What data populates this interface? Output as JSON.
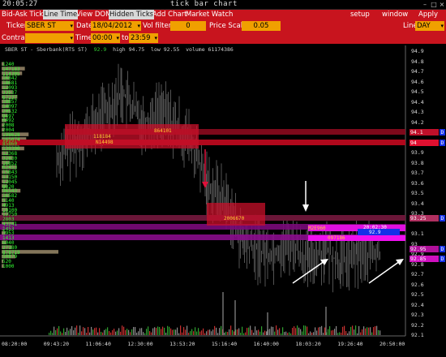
{
  "window": {
    "clock": "20:05:27",
    "title": "tick bar chart"
  },
  "menu": {
    "items": [
      "Bid-Ask Tick",
      "Line Time",
      "View DOM",
      "Hidden Ticks",
      "Add Chart",
      "Market Watch"
    ],
    "right": [
      "setup",
      "window",
      "Apply"
    ]
  },
  "controls": {
    "ticker_label": "Ticker",
    "ticker_value": "SBER ST",
    "date_label": "Date",
    "date_value": "18/04/2012",
    "vol_filter_label": "Vol filter",
    "vol_filter_value": "0",
    "price_scale_label": "Price Scale",
    "price_scale_value": "0.05",
    "line_label": "Line",
    "line_value": "DAY",
    "contract_label": "Contract",
    "time_label": "Time",
    "time_from": "00:00",
    "to_label": "to",
    "time_to": "23:59"
  },
  "chart_info": {
    "instrument": "SBER ST - Sberbank(RTS ST)",
    "last": "92.9",
    "high_label": "high",
    "high": "94.75",
    "low_label": "low",
    "low": "92.55",
    "volume_label": "volume",
    "volume": "61174386"
  },
  "chart_data": {
    "type": "bar",
    "price_axis": [
      "94.9",
      "94.8",
      "94.7",
      "94.6",
      "94.5",
      "94.4",
      "94.3",
      "94.2",
      "94.1",
      "94",
      "93.9",
      "93.8",
      "93.7",
      "93.6",
      "93.5",
      "93.4",
      "93.3",
      "93.25",
      "93.1",
      "93",
      "92.95",
      "92.9",
      "92.85",
      "92.8",
      "92.7",
      "92.6",
      "92.5",
      "92.4",
      "92.3",
      "92.2",
      "92.1"
    ],
    "time_axis": [
      "08:20:00",
      "09:43:20",
      "11:06:40",
      "12:30:00",
      "13:53:20",
      "15:16:40",
      "16:40:00",
      "18:03:20",
      "19:26:40",
      "20:50:00"
    ],
    "ylim": [
      92.1,
      94.9
    ],
    "volume_profile": [
      "1240",
      "147183",
      "114305",
      "16842",
      "18681",
      "12093",
      "33537",
      "67237",
      "18857",
      "14097",
      "20532",
      "9497",
      "6492",
      "2008",
      "2004",
      "198628",
      "165074",
      "85860",
      "139300",
      "12368",
      "32830",
      "16852",
      "62453",
      "15843",
      "13150",
      "12045",
      "8020",
      "96543",
      "16582",
      "5140",
      "4913",
      "10100",
      "12750",
      "2803",
      "43241",
      "1453",
      "3953",
      "1413",
      "6040",
      "27180",
      "878719",
      "50879",
      "520",
      "1000"
    ],
    "levels": [
      {
        "price": "94.1",
        "color": "#c0102a",
        "marker": "D"
      },
      {
        "price": "94",
        "color": "#e01030",
        "marker": "D"
      },
      {
        "price": "93.25",
        "color": "#b03060",
        "marker": "D"
      },
      {
        "price": "92.95",
        "color": "#b0109a",
        "marker": "D"
      },
      {
        "price": "92.85",
        "color": "#d010c0",
        "marker": "D"
      }
    ],
    "zone_labels": [
      "864101",
      "118184",
      "N14498",
      "2006670",
      "M2E960",
      "097186",
      "20:02:30",
      "92.9"
    ]
  },
  "colors": {
    "menu_bg": "#c8141e",
    "field_bg": "#f0a000",
    "profile": "#3f3",
    "level_marker": "#1530e8"
  }
}
